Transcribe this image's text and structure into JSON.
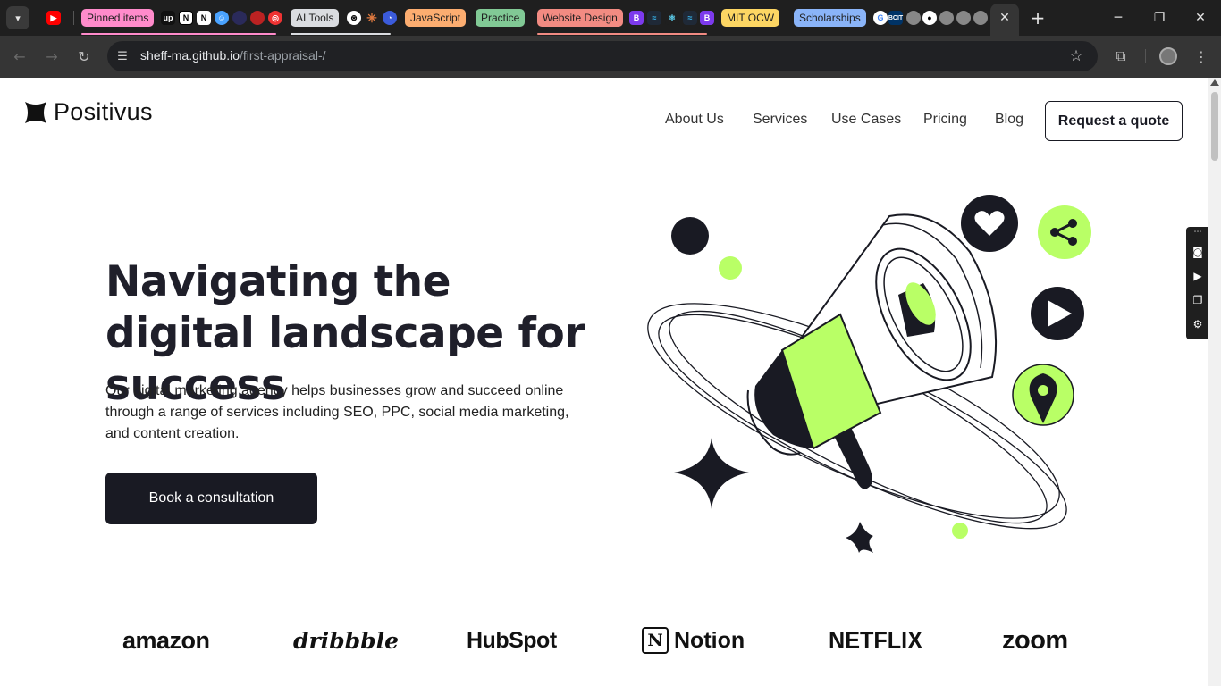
{
  "browser": {
    "tab_groups": [
      {
        "label": "Pinned items",
        "color": "#ff8bcb"
      },
      {
        "label": "AI Tools",
        "color": "#dadce0"
      },
      {
        "label": "JavaScript",
        "color": "#fcad70"
      },
      {
        "label": "Practice",
        "color": "#81c995"
      },
      {
        "label": "Website Design",
        "color": "#f28b82"
      },
      {
        "label": "MIT OCW",
        "color": "#fdd663"
      },
      {
        "label": "Scholarships",
        "color": "#8ab4f8"
      }
    ],
    "url_host": "sheff-ma.github.io",
    "url_path": "/first-appraisal-/"
  },
  "site": {
    "brand": "Positivus",
    "nav": [
      "About Us",
      "Services",
      "Use Cases",
      "Pricing",
      "Blog"
    ],
    "quote_button": "Request a quote",
    "hero_title": "Navigating the digital landscape for success",
    "hero_text": "Our digital marketing agency helps businesses grow and succeed online through a range of services including SEO, PPC, social media marketing, and content creation.",
    "cta": "Book a consultation",
    "accent_color": "#b9ff66",
    "dark_color": "#191a23",
    "client_logos": [
      "amazon",
      "dribbble",
      "HubSpot",
      "Notion",
      "NETFLIX",
      "zoom"
    ]
  }
}
